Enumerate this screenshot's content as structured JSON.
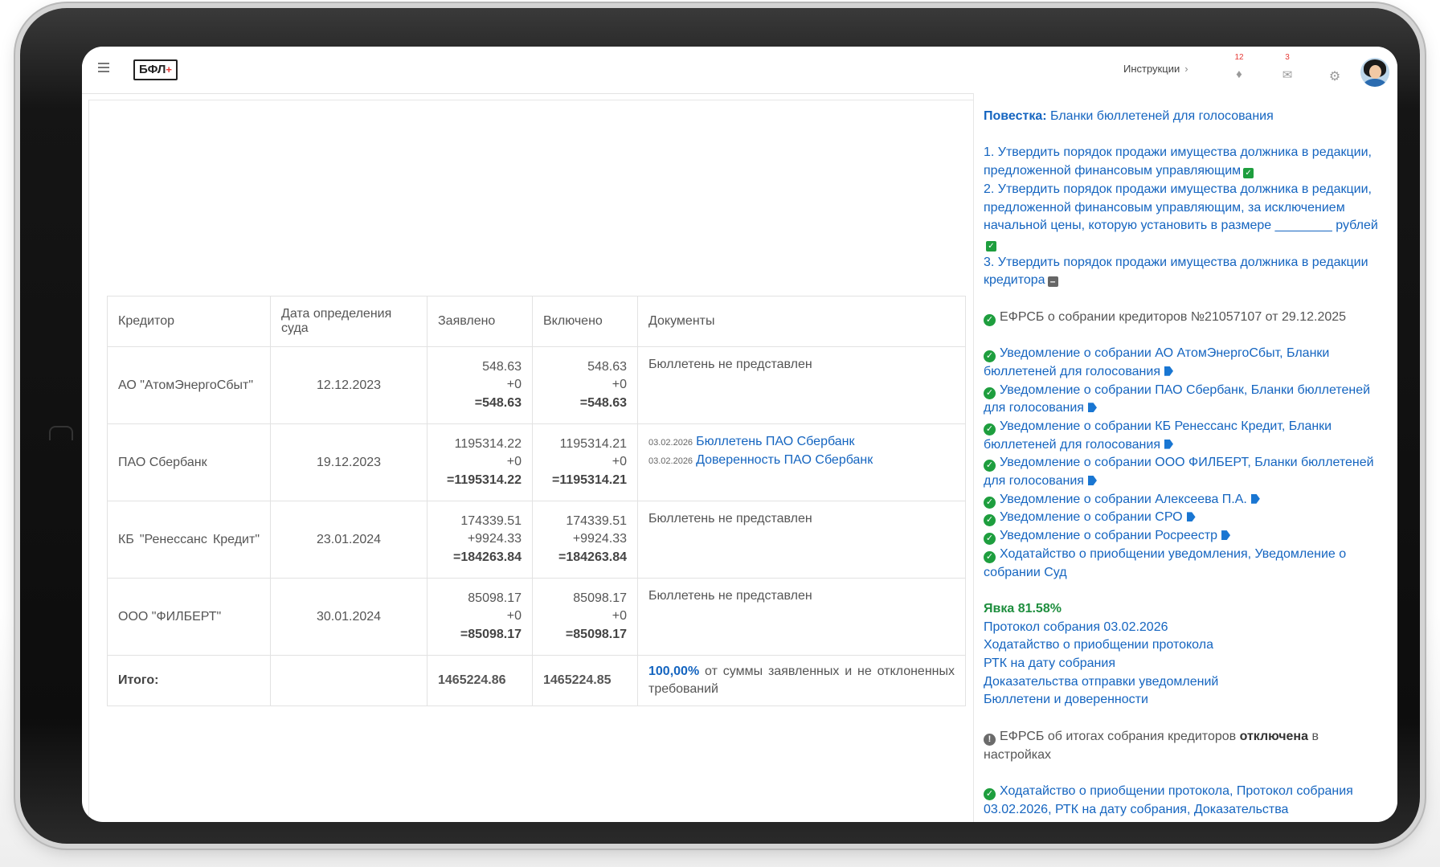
{
  "header": {
    "logo_text": "БФЛ",
    "logo_plus": "+",
    "instructions_label": "Инструкции",
    "notifications_count": "12",
    "messages_count": "3"
  },
  "table": {
    "headers": [
      "Кредитор",
      "Дата определения суда",
      "Заявлено",
      "Включено",
      "Документы"
    ],
    "rows": [
      {
        "name": "АО \"АтомЭнергоСбыт\"",
        "date": "12.12.2023",
        "declared": {
          "base": "548.63",
          "add": "+0",
          "total": "=548.63"
        },
        "included": {
          "base": "548.63",
          "add": "+0",
          "total": "=548.63"
        },
        "documents_text": "Бюллетень не представлен"
      },
      {
        "name": "ПАО Сбербанк",
        "date": "19.12.2023",
        "declared": {
          "base": "1195314.22",
          "add": "+0",
          "total": "=1195314.22"
        },
        "included": {
          "base": "1195314.21",
          "add": "+0",
          "total": "=1195314.21"
        },
        "documents": [
          {
            "date": "03.02.2026",
            "title": "Бюллетень ПАО Сбербанк"
          },
          {
            "date": "03.02.2026",
            "title": "Доверенность ПАО Сбербанк"
          }
        ]
      },
      {
        "name": "КБ \"Ренессанс Кредит\"",
        "date": "23.01.2024",
        "declared": {
          "base": "174339.51",
          "add": "+9924.33",
          "total": "=184263.84"
        },
        "included": {
          "base": "174339.51",
          "add": "+9924.33",
          "total": "=184263.84"
        },
        "documents_text": "Бюллетень не представлен"
      },
      {
        "name": "ООО \"ФИЛБЕРТ\"",
        "date": "30.01.2024",
        "declared": {
          "base": "85098.17",
          "add": "+0",
          "total": "=85098.17"
        },
        "included": {
          "base": "85098.17",
          "add": "+0",
          "total": "=85098.17"
        },
        "documents_text": "Бюллетень не представлен"
      }
    ],
    "total": {
      "label": "Итого:",
      "declared": "1465224.86",
      "included": "1465224.85",
      "percent": "100,00%",
      "percent_text": "от суммы заявленных и не отклоненных требований"
    }
  },
  "agenda": {
    "label": "Повестка:",
    "link": "Бланки бюллетеней для голосования",
    "items": [
      "1. Утвердить порядок продажи имущества должника в редакции, предложенной финансовым управляющим",
      "2. Утвердить порядок продажи имущества должника в редакции, предложенной финансовым управляющим, за исключением начальной цены, которую установить в размере ________ рублей",
      "3. Утвердить порядок продажи имущества должника в редакции кредитора"
    ]
  },
  "efrsb_notice": "ЕФРСБ о собрании кредиторов №21057107 от 29.12.2025",
  "notifications": [
    "Уведомление о собрании АО АтомЭнергоСбыт, Бланки бюллетеней для голосования",
    "Уведомление о собрании ПАО Сбербанк, Бланки бюллетеней для голосования",
    "Уведомление о собрании КБ Ренессанс Кредит, Бланки бюллетеней для голосования",
    "Уведомление о собрании ООО ФИЛБЕРТ, Бланки бюллетеней для голосования",
    "Уведомление о собрании Алексеева П.А.",
    "Уведомление о собрании СРО",
    "Уведомление о собрании Росреестр",
    "Ходатайство о приобщении уведомления, Уведомление о собрании Суд"
  ],
  "turnout": {
    "label": "Явка 81.58%",
    "links": [
      "Протокол собрания 03.02.2026",
      "Ходатайство о приобщении протокола",
      "РТК на дату собрания",
      "Доказательства отправки уведомлений",
      "Бюллетени и доверенности"
    ]
  },
  "efrsb_results": {
    "prefix": "ЕФРСБ об итогах собрания кредиторов",
    "status": "отключена",
    "suffix": "в настройках"
  },
  "final_item": "Ходатайство о приобщении протокола, Протокол собрания 03.02.2026, РТК на дату собрания, Доказательства"
}
